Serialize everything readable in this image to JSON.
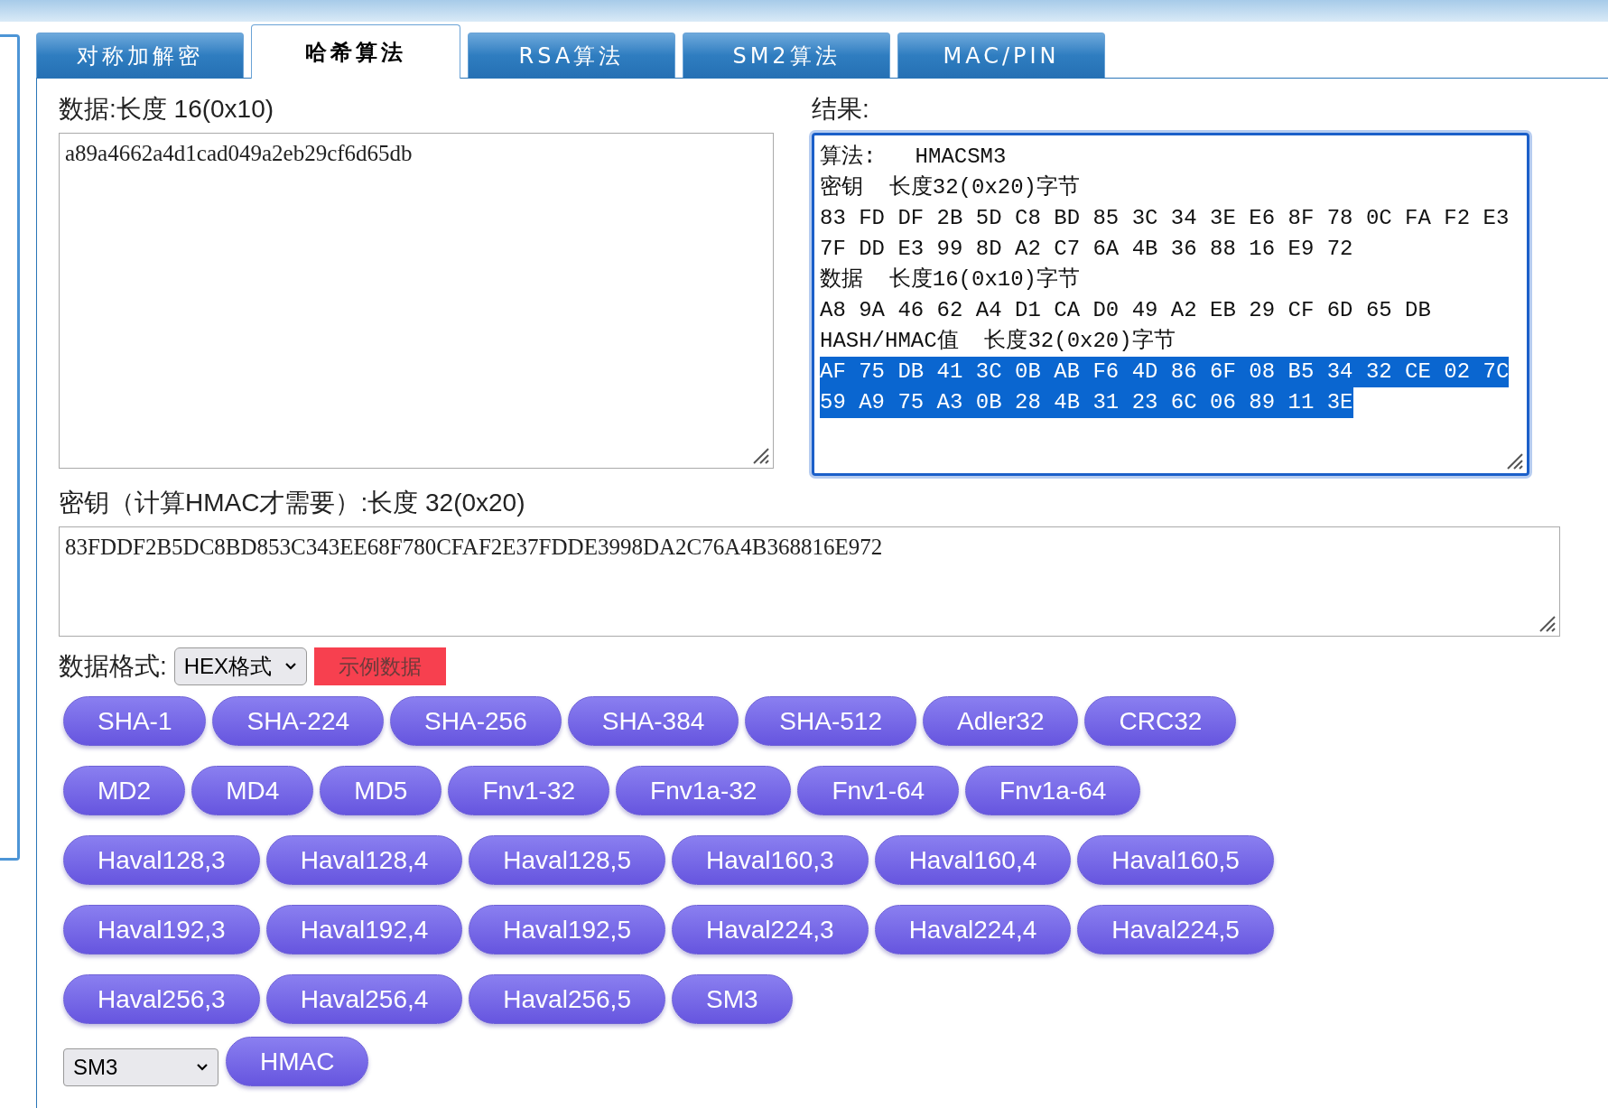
{
  "tabs": [
    {
      "label": "对称加解密",
      "selected": false
    },
    {
      "label": "哈希算法",
      "selected": true
    },
    {
      "label": "RSA算法",
      "selected": false
    },
    {
      "label": "SM2算法",
      "selected": false
    },
    {
      "label": "MAC/PIN",
      "selected": false
    }
  ],
  "data": {
    "label": "数据:长度 16(0x10)",
    "value": "a89a4662a4d1cad049a2eb29cf6d65db"
  },
  "result": {
    "label": "结果:",
    "lines": [
      {
        "text": "算法:   HMACSM3",
        "selected": false
      },
      {
        "text": "密钥  长度32(0x20)字节",
        "selected": false
      },
      {
        "text": "83 FD DF 2B 5D C8 BD 85 3C 34 3E E6 8F 78 0C FA F2 E3",
        "selected": false
      },
      {
        "text": "7F DD E3 99 8D A2 C7 6A 4B 36 88 16 E9 72",
        "selected": false
      },
      {
        "text": "数据  长度16(0x10)字节",
        "selected": false
      },
      {
        "text": "A8 9A 46 62 A4 D1 CA D0 49 A2 EB 29 CF 6D 65 DB",
        "selected": false
      },
      {
        "text": "HASH/HMAC值  长度32(0x20)字节",
        "selected": false
      },
      {
        "text": "AF 75 DB 41 3C 0B AB F6 4D 86 6F 08 B5 34 32 CE 02 7C",
        "selected": true
      },
      {
        "text": "59 A9 75 A3 0B 28 4B 31 23 6C 06 89 11 3E",
        "selected": true
      }
    ]
  },
  "key": {
    "label": "密钥（计算HMAC才需要）:长度 32(0x20)",
    "value": "83FDDF2B5DC8BD853C343EE68F780CFAF2E37FDDE3998DA2C76A4B368816E972"
  },
  "format": {
    "label": "数据格式:",
    "select": "HEX格式",
    "sample_button": "示例数据"
  },
  "algorithm_rows": [
    [
      "SHA-1",
      "SHA-224",
      "SHA-256",
      "SHA-384",
      "SHA-512",
      "Adler32",
      "CRC32"
    ],
    [
      "MD2",
      "MD4",
      "MD5",
      "Fnv1-32",
      "Fnv1a-32",
      "Fnv1-64",
      "Fnv1a-64"
    ],
    [
      "Haval128,3",
      "Haval128,4",
      "Haval128,5",
      "Haval160,3",
      "Haval160,4",
      "Haval160,5"
    ],
    [
      "Haval192,3",
      "Haval192,4",
      "Haval192,5",
      "Haval224,3",
      "Haval224,4",
      "Haval224,5"
    ],
    [
      "Haval256,3",
      "Haval256,4",
      "Haval256,5",
      "SM3"
    ]
  ],
  "hmac": {
    "select": "SM3",
    "button": "HMAC"
  }
}
